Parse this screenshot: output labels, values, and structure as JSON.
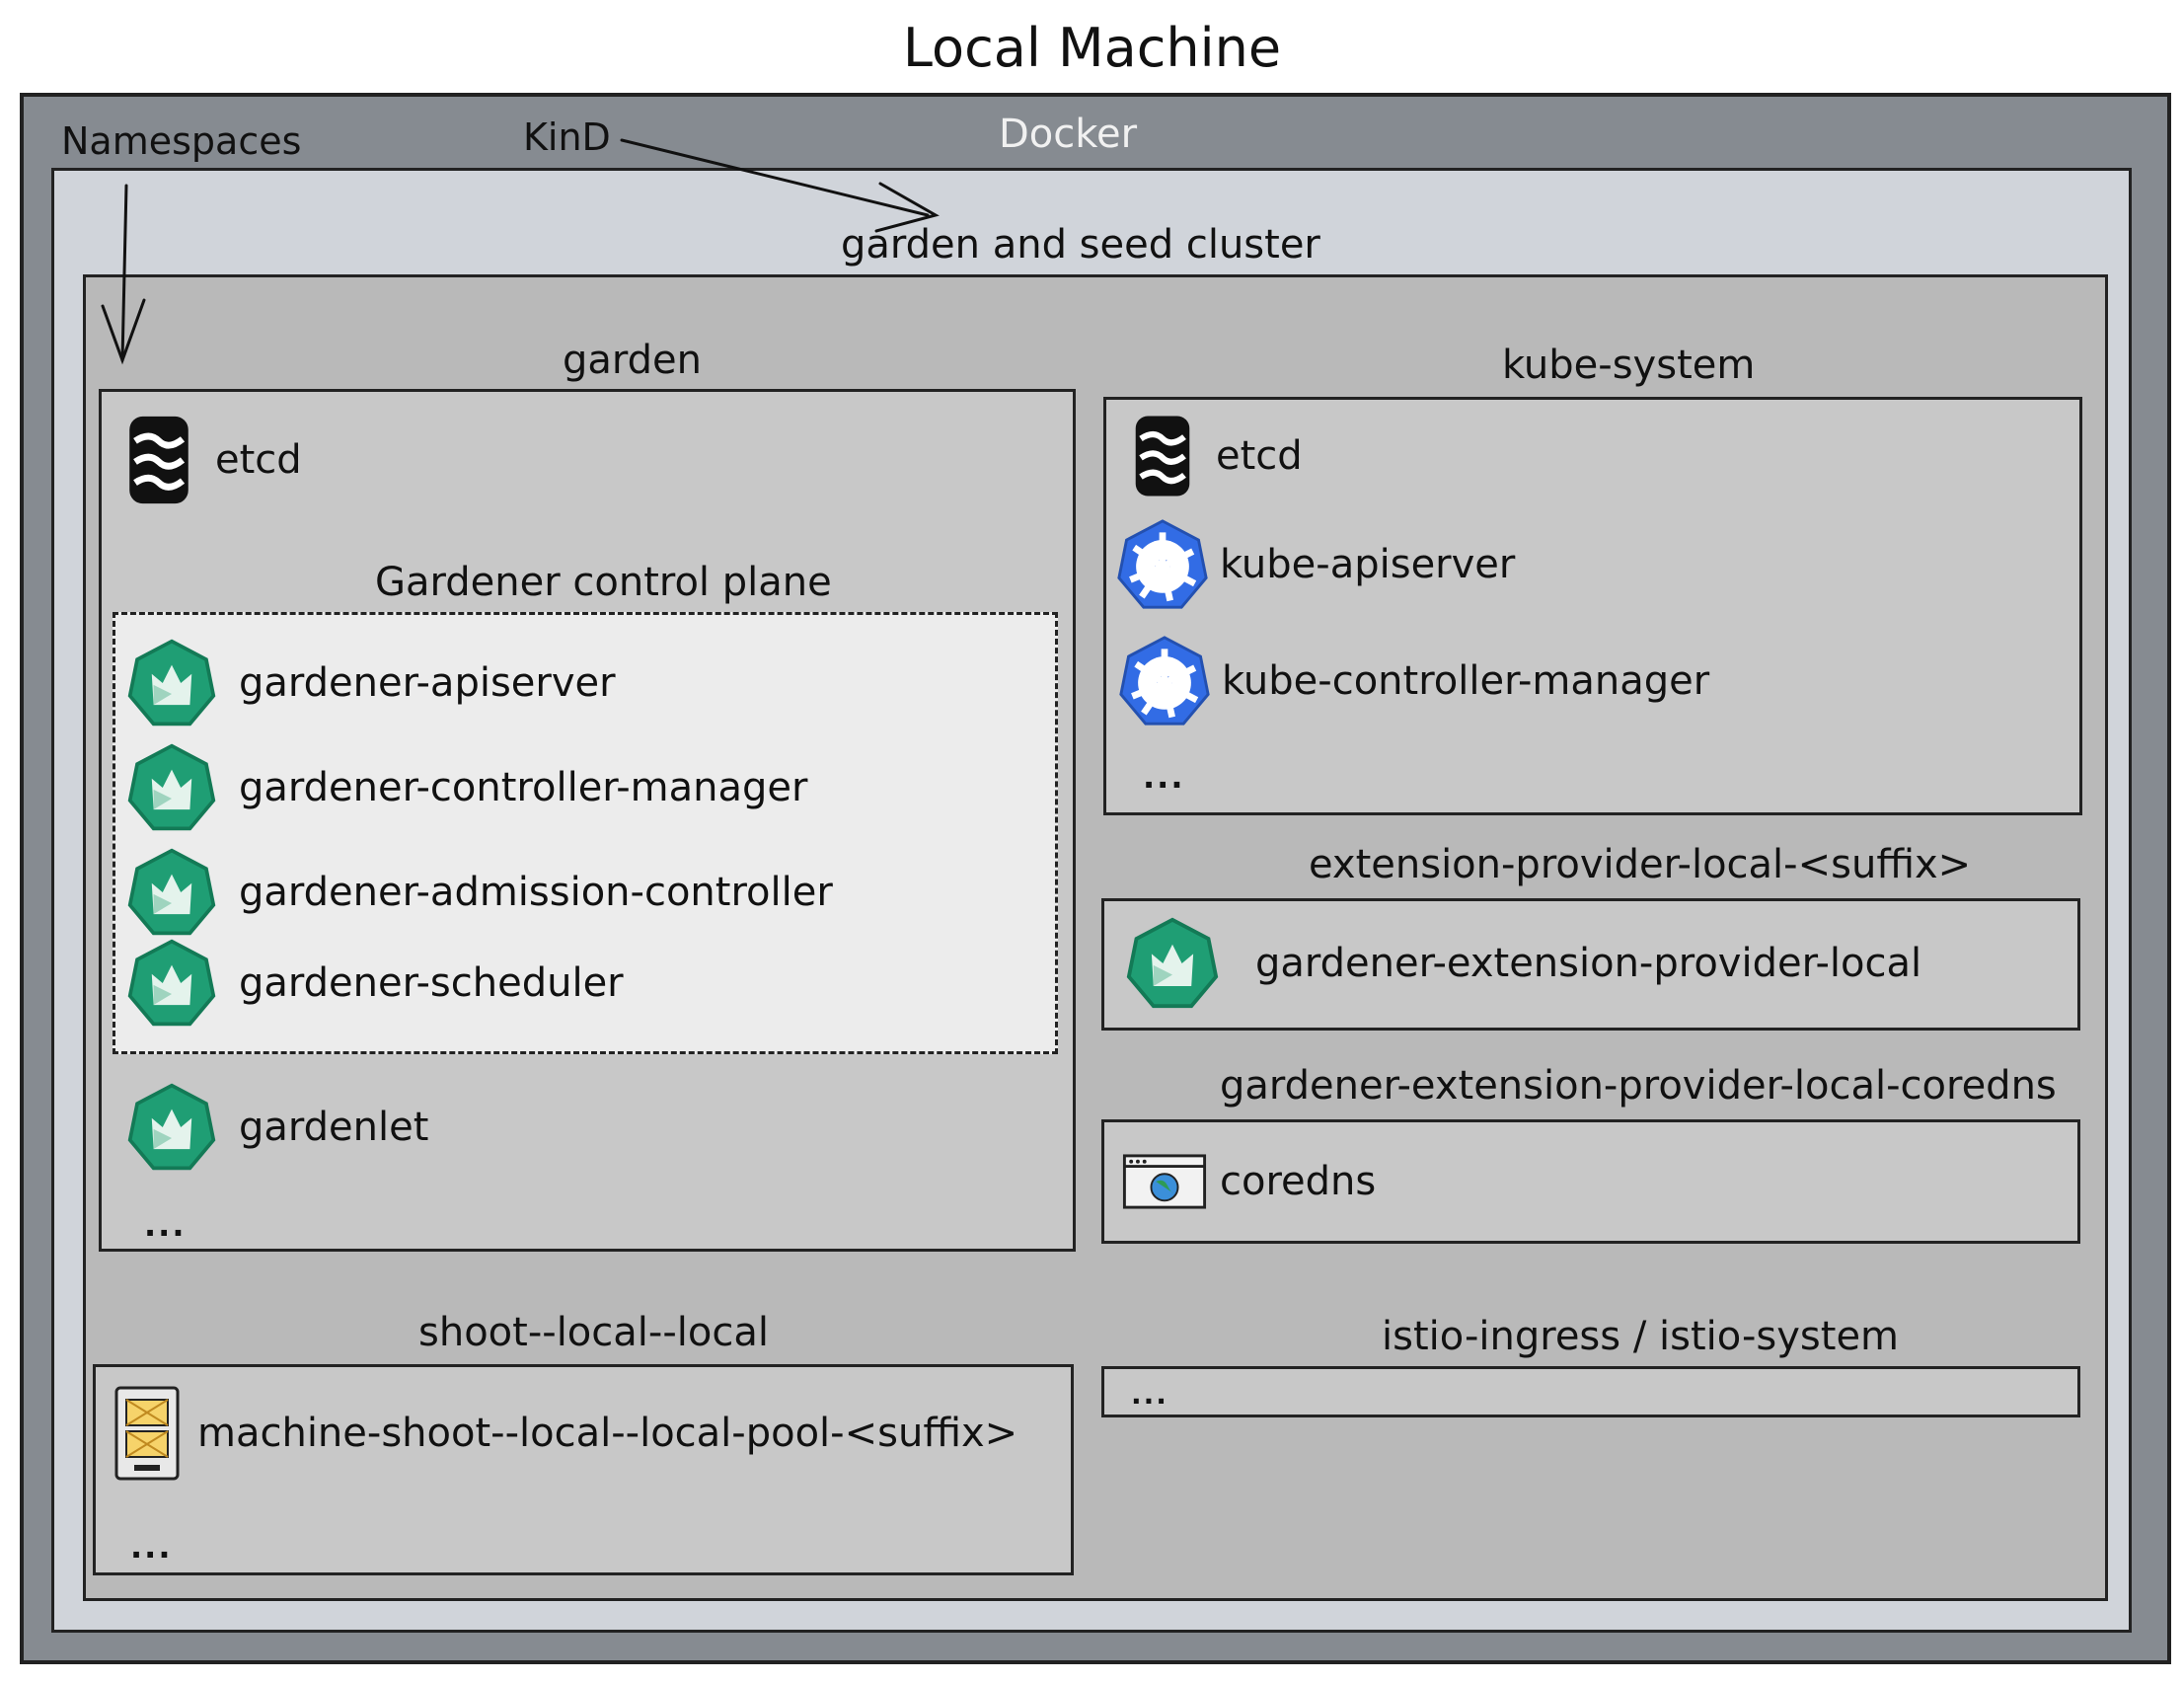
{
  "title": "Local Machine",
  "docker": {
    "label": "Docker"
  },
  "annotations": {
    "namespaces": "Namespaces",
    "kind": "KinD"
  },
  "cluster": {
    "label": "garden and seed cluster"
  },
  "garden": {
    "label": "garden",
    "etcd": "etcd",
    "control_plane": {
      "label": "Gardener control plane",
      "items": [
        "gardener-apiserver",
        "gardener-controller-manager",
        "gardener-admission-controller",
        "gardener-scheduler"
      ]
    },
    "gardenlet": "gardenlet",
    "more": "..."
  },
  "kube_system": {
    "label": "kube-system",
    "items": [
      "etcd",
      "kube-apiserver",
      "kube-controller-manager"
    ],
    "more": "..."
  },
  "extension_provider": {
    "label": "extension-provider-local-<suffix>",
    "item": "gardener-extension-provider-local"
  },
  "coredns_ns": {
    "label": "gardener-extension-provider-local-coredns",
    "item": "coredns"
  },
  "shoot": {
    "label": "shoot--local--local",
    "item": "machine-shoot--local--local-pool-<suffix>",
    "more": "..."
  },
  "istio": {
    "label": "istio-ingress / istio-system",
    "more": "..."
  },
  "colors": {
    "docker_bg": "#868b91",
    "kind_bg": "#d0d4da",
    "cluster_bg": "#b9b9b9",
    "ns_bg": "#c8c8c8",
    "control_plane_bg": "#ececec",
    "gardener_green": "#1f9e74",
    "kubernetes_blue": "#326ce5"
  },
  "icons": {
    "etcd": "etcd-icon",
    "gardener": "gardener-icon",
    "kubernetes": "kubernetes-icon",
    "coredns": "coredns-icon",
    "machine": "machine-icon"
  }
}
